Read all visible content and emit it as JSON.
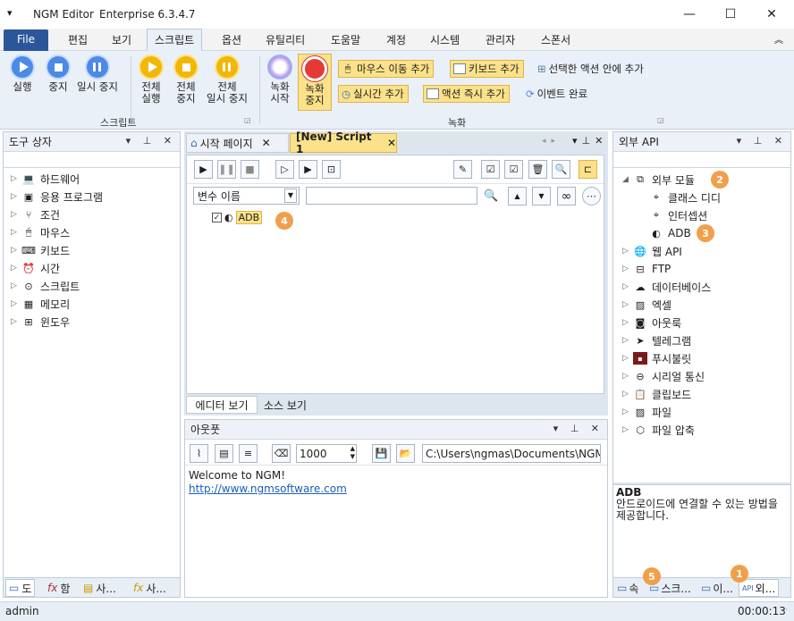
{
  "app": {
    "title": "NGM Editor",
    "edition": "Enterprise 6.3.4.7"
  },
  "window": {
    "minimize": "—",
    "maximize": "☐",
    "close": "✕"
  },
  "menu": {
    "file": "File",
    "items": [
      "편집",
      "보기",
      "스크립트",
      "옵션",
      "유틸리티",
      "도움말",
      "계정",
      "시스템",
      "관리자",
      "스폰서"
    ]
  },
  "ribbon": {
    "script_group": "스크립트",
    "run": "실행",
    "stop": "중지",
    "pause": "일시 중지",
    "run_all_1": "전체",
    "run_all_2": "실행",
    "stop_all_1": "전체",
    "stop_all_2": "중지",
    "pause_all_1": "전체",
    "pause_all_2": "일시 중지",
    "record_group": "녹화",
    "rec_start_1": "녹화",
    "rec_start_2": "시작",
    "rec_stop_1": "녹화",
    "rec_stop_2": "중지",
    "add_mouse": "마우스 이동 추가",
    "add_keyboard": "키보드 추가",
    "add_in_selected": "선택한 액션 안에 추가",
    "add_realtime": "실시간 추가",
    "action_instant_add": "액션 즉시 추가",
    "event_done": "이벤트 완료"
  },
  "toolbox": {
    "title": "도구 상자",
    "items": [
      "하드웨어",
      "응용 프로그램",
      "조건",
      "마우스",
      "키보드",
      "시간",
      "스크립트",
      "메모리",
      "윈도우"
    ],
    "tabs": [
      "도",
      "함",
      "사...",
      "사..."
    ]
  },
  "editor": {
    "tabs": [
      "시작 페이지",
      "[New] Script 1"
    ],
    "var_placeholder": "변수 이름",
    "node": "ADB",
    "bottom_tabs": [
      "에디터 보기",
      "소스 보기"
    ]
  },
  "output": {
    "title": "아웃풋",
    "count": "1000",
    "path": "C:\\Users\\ngmas\\Documents\\NGM6\\",
    "lines": [
      "Welcome to NGM!",
      "http://www.ngmsoftware.com"
    ]
  },
  "external": {
    "title": "외부 API",
    "root": "외부 모듈",
    "children": [
      "클래스 디디",
      "인터셉션",
      "ADB"
    ],
    "items": [
      "웹 API",
      "FTP",
      "데이터베이스",
      "엑셀",
      "아웃룩",
      "텔레그램",
      "푸시불릿",
      "시리얼 통신",
      "클립보드",
      "파일",
      "파일 압축"
    ],
    "desc_title": "ADB",
    "desc": "안드로이드에 연결할 수 있는 방법을 제공합니다.",
    "tabs": [
      "속",
      "스크...",
      "이...",
      "외..."
    ]
  },
  "badges": [
    "1",
    "2",
    "3",
    "4",
    "5"
  ],
  "status": {
    "user": "admin",
    "time": "00:00:13"
  }
}
